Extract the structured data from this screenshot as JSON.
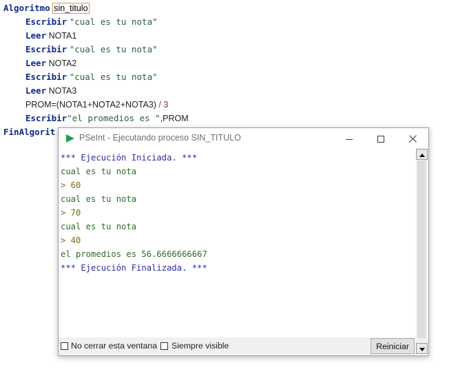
{
  "editor": {
    "l1_kw": "Algoritmo",
    "l1_name": "sin_titulo",
    "l2_kw": "Escribir",
    "l2_str": "\"cual es tu nota\"",
    "l3_kw": "Leer",
    "l3_var": "NOTA1",
    "l4_kw": "Escribir",
    "l4_str": "\"cual es tu nota\"",
    "l5_kw": "Leer",
    "l5_var": "NOTA2",
    "l6_kw": "Escribir",
    "l6_str": "\"cual es tu nota\"",
    "l7_kw": "Leer",
    "l7_var": "NOTA3",
    "l8_expr": "PROM=(NOTA1+NOTA2+NOTA3)",
    "l8_op": "/",
    "l8_num": "3",
    "l9_kw": "Escribir",
    "l9_str": "\"el promedios es \"",
    "l9_rest": ",PROM",
    "l10_kw": "FinAlgorit"
  },
  "window": {
    "title": "PSeInt - Ejecutando proceso SIN_TITULO",
    "app_icon": "pseint-play-icon",
    "minimize_icon": "minimize-icon",
    "maximize_icon": "maximize-icon",
    "close_icon": "close-icon"
  },
  "console": {
    "lines": [
      "*** Ejecución Iniciada. ***",
      "cual es tu nota",
      "> 60",
      "cual es tu nota",
      "> 70",
      "cual es tu nota",
      "> 40",
      "el promedios es 56.6666666667",
      "*** Ejecución Finalizada. ***"
    ]
  },
  "bottom": {
    "no_cerrar": "No cerrar esta ventana",
    "siempre_visible": "Siempre visible",
    "reiniciar": "Reiniciar"
  },
  "colors": {
    "keyword": "#0d2a8a",
    "string": "#2f5d46",
    "console_system": "#2c2ca6",
    "console_output": "#2e6a2e",
    "console_input": "#7a6a12",
    "app_icon_green": "#1aa34a"
  }
}
